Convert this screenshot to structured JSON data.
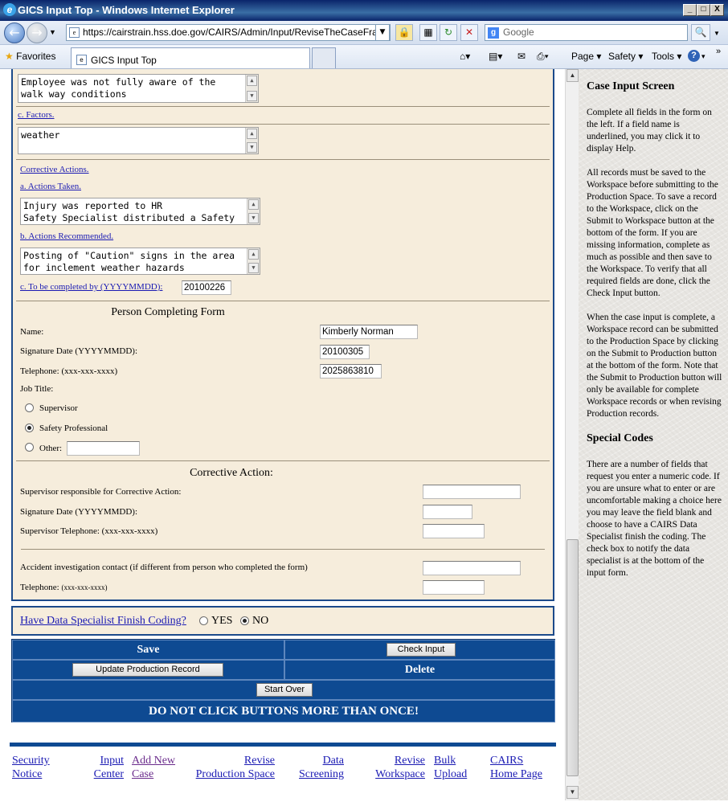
{
  "window": {
    "title": "GICS Input Top - Windows Internet Explorer",
    "buttons": [
      "_",
      "□",
      "X"
    ]
  },
  "browser": {
    "url": "https://cairstrain.hss.doe.gov/CAIRS/Admin/Input/ReviseTheCaseFrame.as",
    "search_placeholder": "Google",
    "favorites_label": "Favorites",
    "tab_title": "GICS Input Top",
    "commands": {
      "page": "Page",
      "safety": "Safety",
      "tools": "Tools",
      "help": "?"
    }
  },
  "form": {
    "factors_text": "Employee was not fully aware of the\nwalk way conditions",
    "factors_label": "c. Factors.",
    "factors_value": "weather",
    "corrective_actions_label": "Corrective Actions.",
    "actions_taken_label": "a. Actions Taken.",
    "actions_taken_value": "Injury was reported to HR\nSafety Specialist distributed a Safety",
    "actions_recommended_label": "b. Actions Recommended.",
    "actions_recommended_value": "Posting of \"Caution\" signs in the area\nfor inclement weather hazards",
    "complete_by_label": "c. To be completed by (YYYYMMDD):",
    "complete_by_value": "20100226",
    "person_section": "Person Completing Form",
    "name_label": "Name:",
    "name_value": "Kimberly Norman",
    "sigdate_label": "Signature Date (YYYYMMDD):",
    "sigdate_value": "20100305",
    "phone_label": "Telephone: (xxx-xxx-xxxx)",
    "phone_value": "2025863810",
    "jobtitle_label": "Job Title:",
    "job_supervisor": "Supervisor",
    "job_safety": "Safety Professional",
    "job_other": "Other:",
    "job_selected": "Safety Professional",
    "ca_section": "Corrective Action:",
    "ca_supervisor_label": "Supervisor responsible for Corrective Action:",
    "ca_sigdate_label": "Signature Date (YYYYMMDD):",
    "ca_phone_label": "Supervisor Telephone: (xxx-xxx-xxxx)",
    "contact_label": "Accident investigation contact (if different from person who completed the form)",
    "contact_phone_label": "Telephone:",
    "contact_phone_hint": "(xxx-xxx-xxxx)"
  },
  "data_specialist": {
    "label": "Have Data Specialist Finish Coding?",
    "yes": "YES",
    "no": "NO",
    "selected": "NO"
  },
  "buttons": {
    "save": "Save",
    "check_input": "Check Input",
    "update_production": "Update Production Record",
    "delete": "Delete",
    "start_over": "Start Over",
    "warning": "DO NOT CLICK BUTTONS MORE THAN ONCE!"
  },
  "footer_links": [
    {
      "line1": "Security",
      "line2": "Notice"
    },
    {
      "line1": "Input",
      "line2": "Center"
    },
    {
      "line1": "Add New",
      "line2": "Case"
    },
    {
      "line1": "Revise",
      "line2": "Production Space"
    },
    {
      "line1": "Data",
      "line2": "Screening"
    },
    {
      "line1": "Revise",
      "line2": "Workspace"
    },
    {
      "line1": "Bulk",
      "line2": "Upload"
    },
    {
      "line1": "CAIRS",
      "line2": "Home Page"
    }
  ],
  "help": {
    "title": "Case Input Screen",
    "p1": "Complete all fields in the form on the left. If a field name is underlined, you may click it to display Help.",
    "p2": "All records must be saved to the Workspace before submitting to the Production Space. To save a record to the Workspace, click on the Submit to Workspace button at the bottom of the form. If you are missing information, complete as much as possible and then save to the Workspace. To verify that all required fields are done, click the Check Input button.",
    "p3": "When the case input is complete, a Workspace record can be submitted to the Production Space by clicking on the Submit to Production button at the bottom of the form. Note that the Submit to Production button will only be available for complete Workspace records or when revising Production records.",
    "title2": "Special Codes",
    "p4": "There are a number of fields that request you enter a numeric code. If you are unsure what to enter or are uncomfortable making a choice here you may leave the field blank and choose to have a CAIRS Data Specialist finish the coding. The check box to notify the data specialist is at the bottom of the input form."
  }
}
